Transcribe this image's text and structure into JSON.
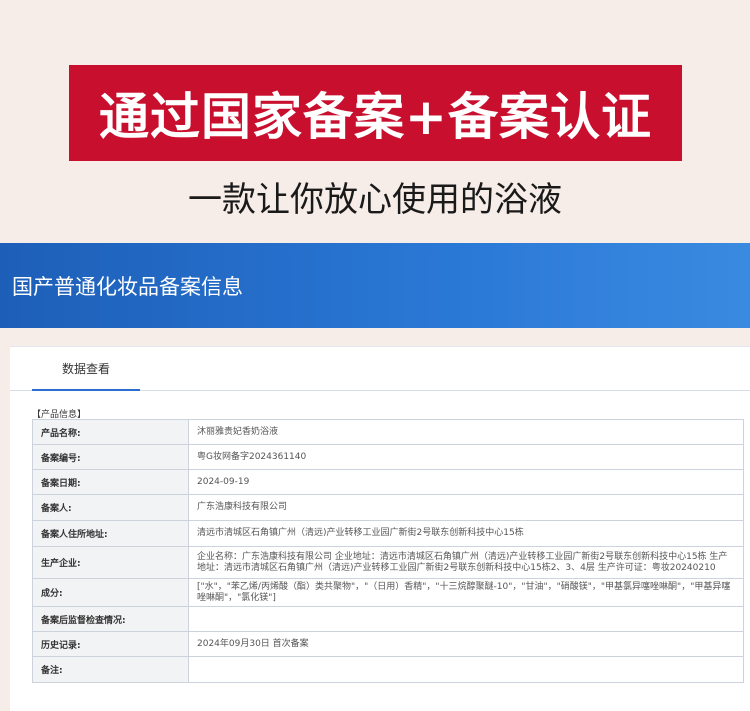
{
  "banner": {
    "title": "通过国家备案+备案认证",
    "subtitle": "一款让你放心使用的浴液"
  },
  "portal": {
    "title": "国产普通化妆品备案信息",
    "tab_label": "数据查看",
    "section_label": "【产品信息】"
  },
  "rows": [
    {
      "label": "产品名称:",
      "value": "沐丽雅贵妃香奶浴液"
    },
    {
      "label": "备案编号:",
      "value": "粤G妆网备字2024361140"
    },
    {
      "label": "备案日期:",
      "value": "2024-09-19"
    },
    {
      "label": "备案人:",
      "value": "广东浩康科技有限公司"
    },
    {
      "label": "备案人住所地址:",
      "value": "清远市清城区石角镇广州（清远)产业转移工业园广新街2号联东创新科技中心15栋"
    },
    {
      "label": "生产企业:",
      "value": "企业名称：广东浩康科技有限公司 企业地址：清远市清城区石角镇广州（清远)产业转移工业园广新街2号联东创新科技中心15栋 生产地址：清远市清城区石角镇广州（清远)产业转移工业园广新街2号联东创新科技中心15栋2、3、4层 生产许可证：粤妆20240210"
    },
    {
      "label": "成分:",
      "value": "[\"水\"，\"苯乙烯/丙烯酸（酯）类共聚物\"，\"（日用）香精\"，\"十三烷醇聚醚-10\"，\"甘油\"，\"硝酸镁\"，\"甲基氯异噻唑啉酮\"，\"甲基异噻唑啉酮\"，\"氯化镁\"]"
    },
    {
      "label": "备案后监督检查情况:",
      "value": ""
    },
    {
      "label": "历史记录:",
      "value": "2024年09月30日 首次备案"
    },
    {
      "label": "备注:",
      "value": ""
    }
  ]
}
